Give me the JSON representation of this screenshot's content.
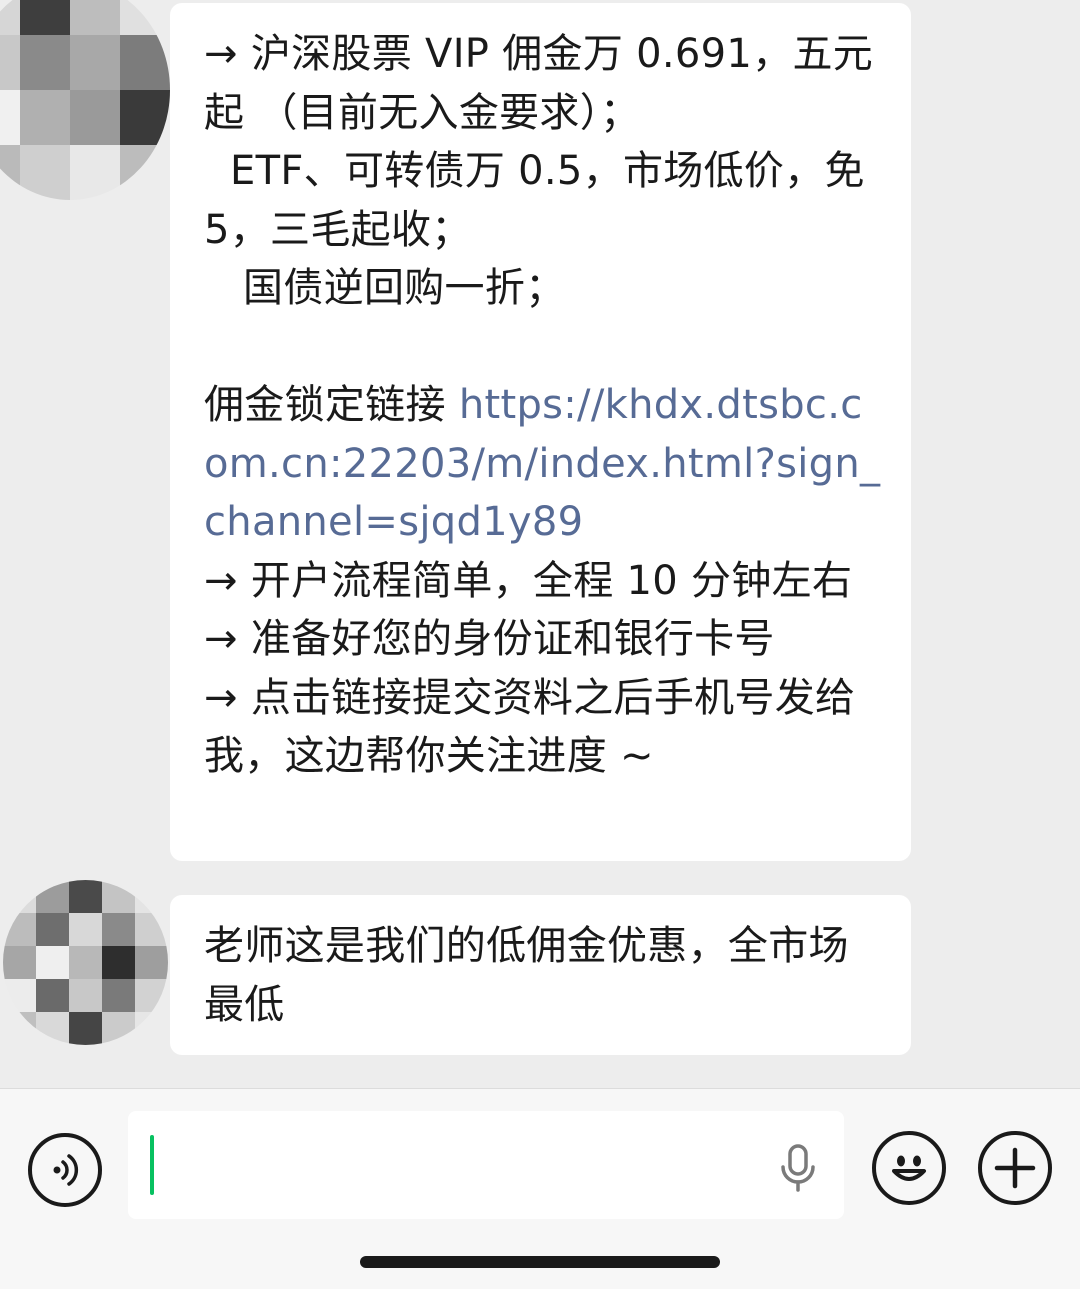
{
  "chat": {
    "incoming_message_1": {
      "line1": "→ 沪深股票 VIP 佣金万 0.691，五元起 （目前无入金要求）；",
      "line2": "  ETF、可转债万 0.5，市场低价，免 5，三毛起收；",
      "line3": "   国债逆回购一折；",
      "link_label": "佣金锁定链接 ",
      "link_url": "https://khdx.dtsbc.com.cn:22203/m/index.html?sign_channel=sjqd1y89",
      "line4": "→ 开户流程简单，全程 10 分钟左右",
      "line5": "→ 准备好您的身份证和银行卡号",
      "line6": "→ 点击链接提交资料之后手机号发给我，这边帮你关注进度 ~"
    },
    "incoming_message_2": {
      "text": "老师这是我们的低佣金优惠，全市场最低"
    }
  },
  "input_bar": {
    "voice_icon": "voice-toggle-icon",
    "mic_icon": "microphone-icon",
    "emoji_icon": "emoji-icon",
    "plus_icon": "plus-icon",
    "input_value": ""
  },
  "colors": {
    "link": "#576b95",
    "caret": "#07c160",
    "background": "#ededed",
    "bubble": "#ffffff"
  }
}
